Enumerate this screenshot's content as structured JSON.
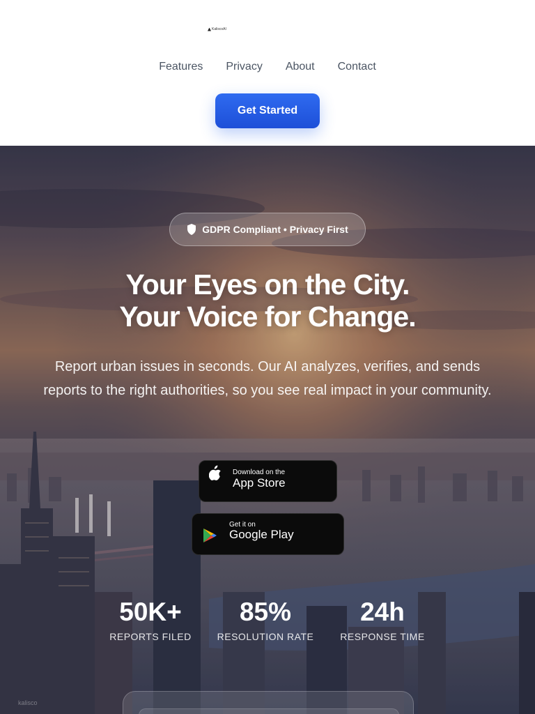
{
  "header": {
    "logo_text": "KaliscoAI",
    "nav": [
      {
        "label": "Features"
      },
      {
        "label": "Privacy"
      },
      {
        "label": "About"
      },
      {
        "label": "Contact"
      }
    ],
    "cta_label": "Get Started",
    "accent_color": "#2563eb"
  },
  "hero": {
    "badge": {
      "icon": "shield-icon",
      "text": "GDPR Compliant • Privacy First"
    },
    "headline_line1": "Your Eyes on the City.",
    "headline_line2": "Your Voice for Change.",
    "subtitle": "Report urban issues in seconds. Our AI analyzes, verifies, and sends reports to the right authorities, so you see real impact in your community.",
    "app_store": {
      "icon": "apple-icon",
      "small": "Download on the",
      "big": "App Store"
    },
    "google_play": {
      "icon": "google-play-icon",
      "small": "Get it on",
      "big": "Google Play"
    },
    "stats": [
      {
        "value": "50K+",
        "label": "REPORTS FILED"
      },
      {
        "value": "85%",
        "label": "RESOLUTION RATE"
      },
      {
        "value": "24h",
        "label": "RESPONSE TIME"
      }
    ],
    "background_image": "city-skyline-photo",
    "watermark": "kalisco"
  }
}
